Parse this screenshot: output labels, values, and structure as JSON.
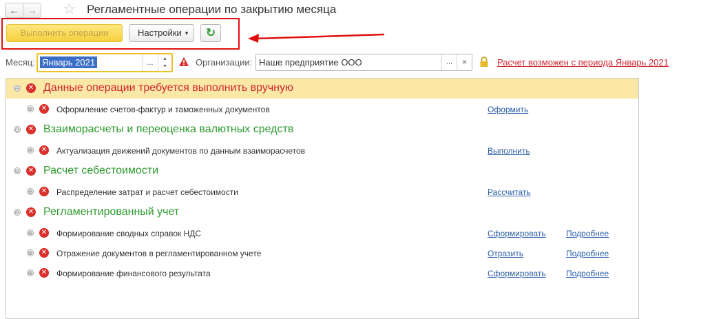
{
  "header": {
    "back_icon": "←",
    "forward_icon": "→",
    "star_icon": "☆",
    "title": "Регламентные операции по закрытию месяца"
  },
  "toolbar": {
    "execute_label": "Выполнить операции",
    "settings_label": "Настройки",
    "settings_caret": "▾",
    "refresh_icon": "↻"
  },
  "filters": {
    "month_label": "Месяц:",
    "month_value": "Январь 2021",
    "month_ellipsis": "...",
    "org_label": "Организации:",
    "org_value": "Наше предприятие ООО",
    "org_ellipsis": "...",
    "org_clear": "×",
    "period_link": "Расчет возможен с периода Январь 2021"
  },
  "icons": {
    "collapse": "⊖",
    "expand": "⊕",
    "error": "✕"
  },
  "colors": {
    "accent_yellow": "#f6cf3e",
    "error_red": "#d9302c",
    "group_green": "#2d9a2d",
    "link_blue": "#2a5ea8",
    "selection": "#fbe8a6"
  },
  "groups": [
    {
      "title": "Данные операции требуется выполнить вручную",
      "items": [
        {
          "text": "Оформление счетов-фактур и таможенных документов",
          "action": "Оформить",
          "more": ""
        }
      ]
    },
    {
      "title": "Взаиморасчеты и переоценка валютных средств",
      "items": [
        {
          "text": "Актуализация движений документов по данным взаиморасчетов",
          "action": "Выполнить",
          "more": ""
        }
      ]
    },
    {
      "title": "Расчет себестоимости",
      "items": [
        {
          "text": "Распределение затрат и расчет себестоимости",
          "action": "Рассчитать",
          "more": ""
        }
      ]
    },
    {
      "title": "Регламентированный учет",
      "items": [
        {
          "text": "Формирование сводных справок НДС",
          "action": "Сформировать",
          "more": "Подробнее"
        },
        {
          "text": "Отражение документов в регламентированном учете",
          "action": "Отразить",
          "more": "Подробнее"
        },
        {
          "text": "Формирование финансового результата",
          "action": "Сформировать",
          "more": "Подробнее"
        }
      ]
    }
  ]
}
